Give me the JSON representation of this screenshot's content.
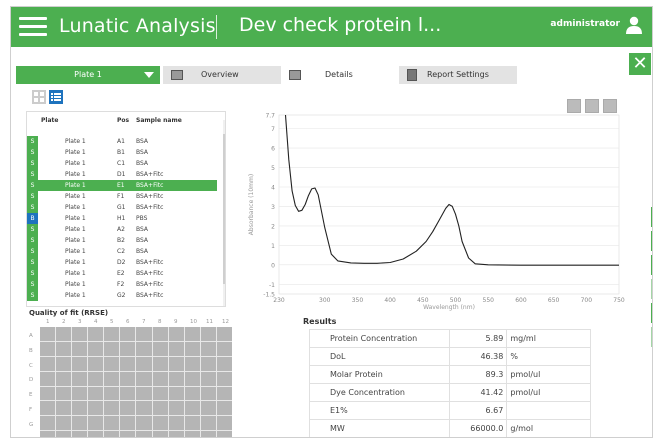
{
  "header": {
    "app_title": "Lunatic Analysis",
    "doc_title": "Dev check protein l...",
    "user": "administrator"
  },
  "tabs": {
    "plate_select": "Plate 1",
    "items": [
      {
        "label": "Overview"
      },
      {
        "label": "Details"
      },
      {
        "label": "Report Settings"
      }
    ]
  },
  "table": {
    "headers": {
      "plate": "Plate",
      "pos": "Pos",
      "sample": "Sample name"
    },
    "rows": [
      {
        "status": "S",
        "plate": "Plate 1",
        "pos": "A1",
        "sample": "BSA",
        "selected": false
      },
      {
        "status": "S",
        "plate": "Plate 1",
        "pos": "B1",
        "sample": "BSA",
        "selected": false
      },
      {
        "status": "S",
        "plate": "Plate 1",
        "pos": "C1",
        "sample": "BSA",
        "selected": false
      },
      {
        "status": "S",
        "plate": "Plate 1",
        "pos": "D1",
        "sample": "BSA+Fitc",
        "selected": false
      },
      {
        "status": "S",
        "plate": "Plate 1",
        "pos": "E1",
        "sample": "BSA+Fitc",
        "selected": true
      },
      {
        "status": "S",
        "plate": "Plate 1",
        "pos": "F1",
        "sample": "BSA+Fitc",
        "selected": false
      },
      {
        "status": "S",
        "plate": "Plate 1",
        "pos": "G1",
        "sample": "BSA+Fitc",
        "selected": false
      },
      {
        "status": "B",
        "plate": "Plate 1",
        "pos": "H1",
        "sample": "PBS",
        "selected": false
      },
      {
        "status": "S",
        "plate": "Plate 1",
        "pos": "A2",
        "sample": "BSA",
        "selected": false
      },
      {
        "status": "S",
        "plate": "Plate 1",
        "pos": "B2",
        "sample": "BSA",
        "selected": false
      },
      {
        "status": "S",
        "plate": "Plate 1",
        "pos": "C2",
        "sample": "BSA",
        "selected": false
      },
      {
        "status": "S",
        "plate": "Plate 1",
        "pos": "D2",
        "sample": "BSA+Fitc",
        "selected": false
      },
      {
        "status": "S",
        "plate": "Plate 1",
        "pos": "E2",
        "sample": "BSA+Fitc",
        "selected": false
      },
      {
        "status": "S",
        "plate": "Plate 1",
        "pos": "F2",
        "sample": "BSA+Fitc",
        "selected": false
      },
      {
        "status": "S",
        "plate": "Plate 1",
        "pos": "G2",
        "sample": "BSA+Fitc",
        "selected": false
      }
    ]
  },
  "quality": {
    "title": "Quality of fit (RRSE)",
    "columns": [
      "1",
      "2",
      "3",
      "4",
      "5",
      "6",
      "7",
      "8",
      "9",
      "10",
      "11",
      "12"
    ],
    "rows": [
      "A",
      "B",
      "C",
      "D",
      "E",
      "F",
      "G",
      "H"
    ]
  },
  "results": {
    "title": "Results",
    "items": [
      {
        "label": "Protein Concentration",
        "value": "5.89",
        "unit": "mg/ml"
      },
      {
        "label": "DoL",
        "value": "46.38",
        "unit": "%"
      },
      {
        "label": "Molar Protein",
        "value": "89.3",
        "unit": "pmol/ul"
      },
      {
        "label": "Dye Concentration",
        "value": "41.42",
        "unit": "pmol/ul"
      },
      {
        "label": "E1%",
        "value": "6.67",
        "unit": ""
      },
      {
        "label": "MW",
        "value": "66000.0",
        "unit": "g/mol"
      }
    ]
  },
  "colors": {
    "accent": "#4caf50",
    "blank": "#1e73be"
  },
  "chart_data": {
    "type": "line",
    "title": "",
    "xlabel": "Wavelength (nm)",
    "ylabel": "Absorbance (10mm)",
    "xlim": [
      230,
      750
    ],
    "ylim": [
      -1.5,
      7.7
    ],
    "xticks": [
      230,
      300,
      350,
      400,
      450,
      500,
      550,
      600,
      650,
      700,
      750
    ],
    "yticks": [
      7.7,
      7,
      6,
      5,
      4,
      3,
      2,
      1,
      0,
      -1,
      -1.5
    ],
    "grid": true,
    "series": [
      {
        "x": [
          240,
          245,
          250,
          255,
          260,
          265,
          270,
          275,
          280,
          285,
          290,
          300,
          310,
          320,
          340,
          360,
          380,
          400,
          420,
          440,
          455,
          465,
          475,
          485,
          490,
          495,
          500,
          505,
          510,
          520,
          530,
          550,
          600,
          650,
          700,
          750
        ],
        "y": [
          7.7,
          5.4,
          3.8,
          3.05,
          2.75,
          2.8,
          3.1,
          3.55,
          3.9,
          3.95,
          3.6,
          1.9,
          0.55,
          0.2,
          0.1,
          0.08,
          0.08,
          0.12,
          0.3,
          0.7,
          1.2,
          1.7,
          2.3,
          2.9,
          3.1,
          3.0,
          2.6,
          2.0,
          1.2,
          0.35,
          0.05,
          0.0,
          -0.02,
          -0.02,
          -0.02,
          -0.02
        ]
      }
    ]
  }
}
